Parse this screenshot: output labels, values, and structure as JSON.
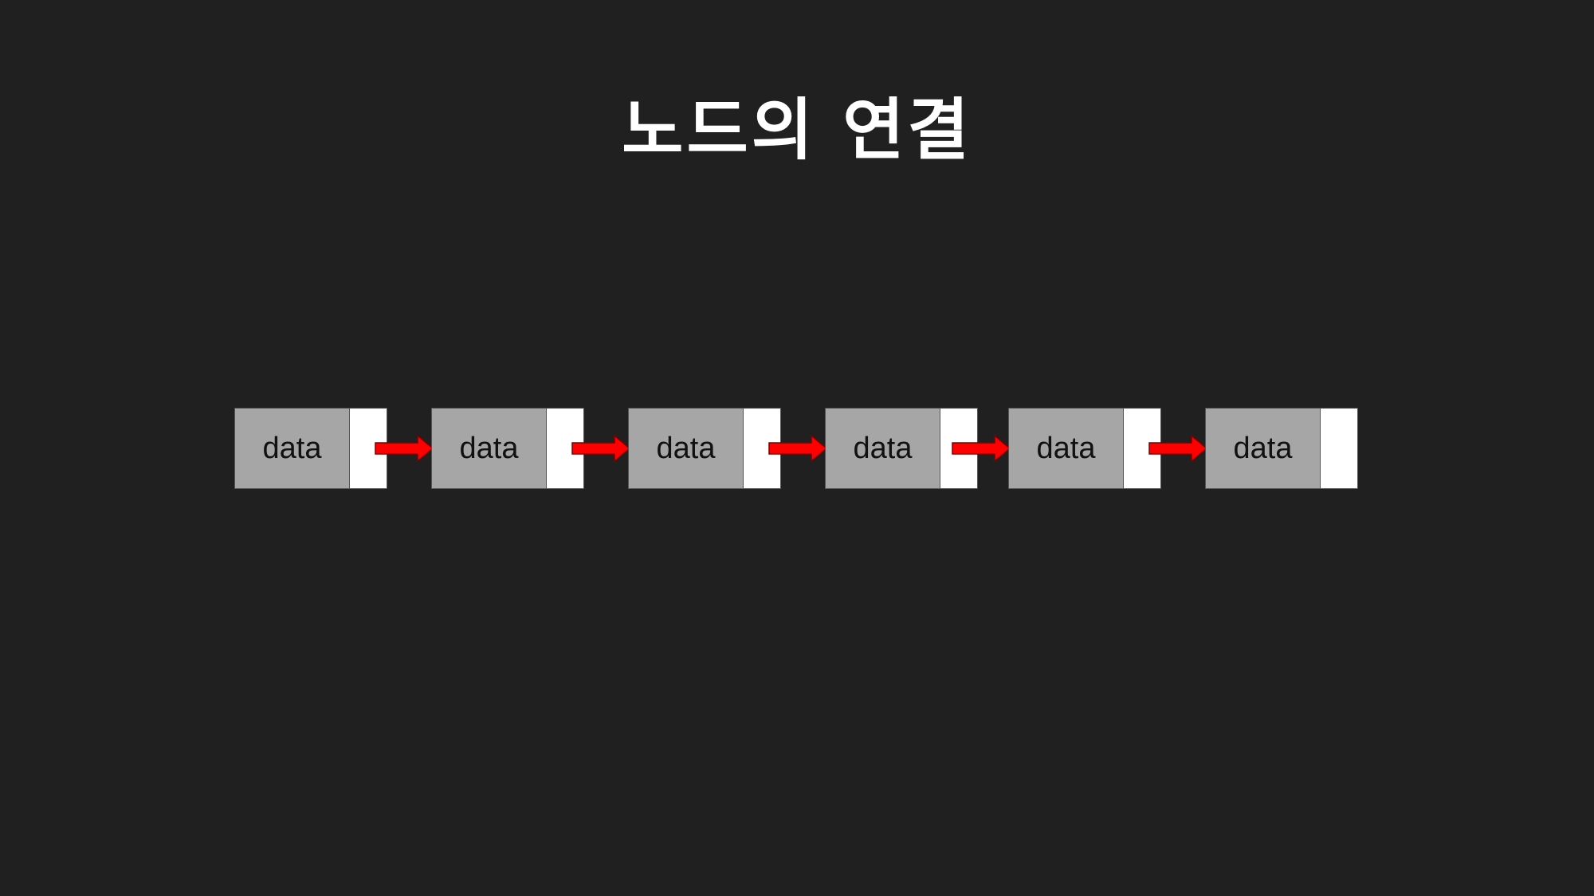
{
  "slide": {
    "title": "노드의 연결"
  },
  "diagram": {
    "nodes": [
      {
        "label": "data"
      },
      {
        "label": "data"
      },
      {
        "label": "data"
      },
      {
        "label": "data"
      },
      {
        "label": "data"
      },
      {
        "label": "data"
      }
    ],
    "colors": {
      "background": "#202020",
      "node_data_fill": "#a6a6a6",
      "node_link_fill": "#ffffff",
      "arrow": "#ff0000"
    }
  }
}
